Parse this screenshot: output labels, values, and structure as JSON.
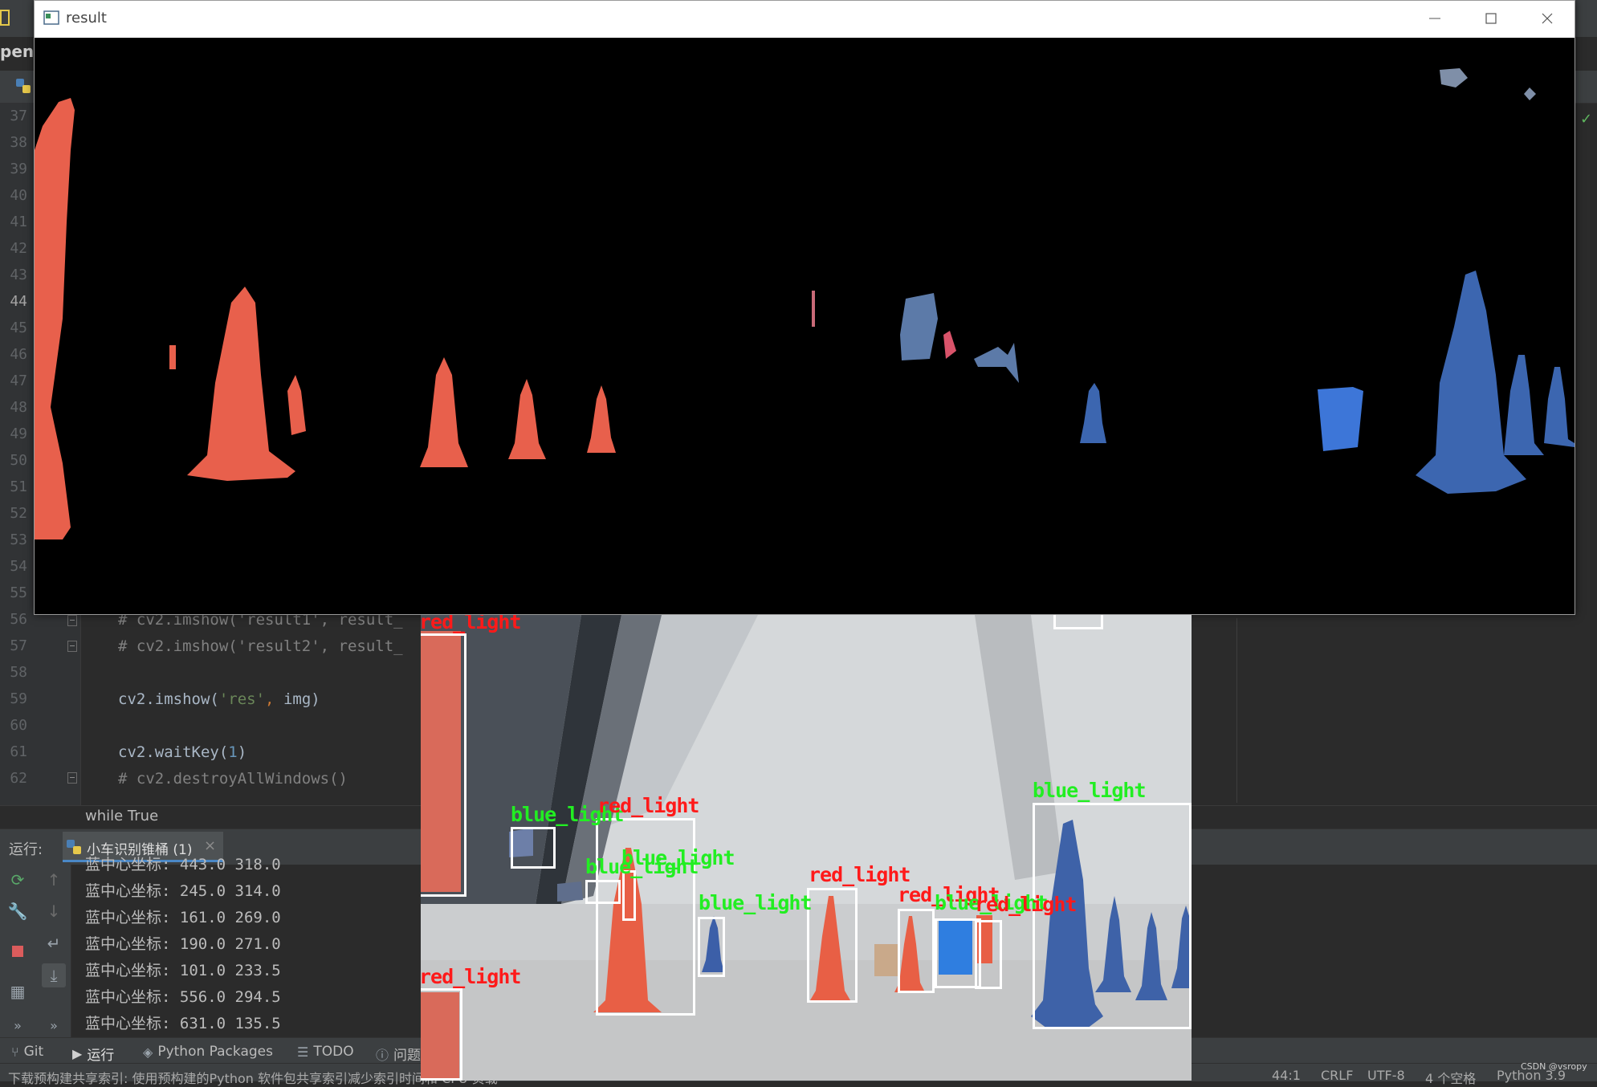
{
  "ide": {
    "project_stub": "penc",
    "gutter_lines": [
      "37",
      "38",
      "39",
      "40",
      "41",
      "42",
      "43",
      "44",
      "45",
      "46",
      "47",
      "48",
      "49",
      "50",
      "51",
      "52",
      "53",
      "54",
      "55",
      "56",
      "57",
      "58",
      "59",
      "60",
      "61",
      "62"
    ],
    "current_line": "44",
    "code": {
      "l56": {
        "text": "# cv2.imshow('result1', result_"
      },
      "l57": {
        "text": "# cv2.imshow('result2', result_"
      },
      "l59": {
        "fn": "cv2.imshow(",
        "str": "'res'",
        "comma": ", ",
        "rest": "img)"
      },
      "l61": {
        "fn": "cv2.waitKey(",
        "num": "1",
        "close": ")"
      },
      "l62": {
        "text": "# cv2.destroyAllWindows()"
      }
    },
    "breadcrumb": "while True"
  },
  "run_panel": {
    "label": "运行:",
    "tab_label": "小车识别锥桶 (1)",
    "tab_close": "×",
    "console_lines": [
      "蓝中心坐标: 443.0 318.0",
      "蓝中心坐标: 245.0 314.0",
      "蓝中心坐标: 161.0 269.0",
      "蓝中心坐标: 190.0 271.0",
      "蓝中心坐标: 101.0 233.5",
      "蓝中心坐标: 556.0 294.5",
      "蓝中心坐标: 631.0 135.5"
    ]
  },
  "tool_tabs": {
    "git": "Git",
    "run": "运行",
    "packages": "Python Packages",
    "todo": "TODO",
    "problems": "问题"
  },
  "status_bar": {
    "message": "下载预构建共享索引: 使用预构建的Python 软件包共享索引减少索引时间和 CPU 负载",
    "position": "44:1",
    "line_sep": "CRLF",
    "encoding": "UTF-8",
    "indent": "4 个空格",
    "interpreter": "Python 3.9"
  },
  "watermark": "CSDN @vsropy",
  "result_window": {
    "title": "result"
  },
  "res_window": {
    "detections": [
      {
        "label": "red_light",
        "color": "red"
      },
      {
        "label": "red_light",
        "color": "red"
      },
      {
        "label": "blue_light",
        "color": "blue"
      },
      {
        "label": "red_light",
        "color": "red"
      },
      {
        "label": "blue_light",
        "color": "blue"
      },
      {
        "label": "blue_light",
        "color": "blue"
      },
      {
        "label": "blue_light",
        "color": "blue"
      },
      {
        "label": "red_light",
        "color": "red"
      },
      {
        "label": "red_light",
        "color": "red"
      },
      {
        "label": "blue_light",
        "color": "blue"
      },
      {
        "label": "red_light",
        "color": "red"
      },
      {
        "label": "blue_light",
        "color": "blue"
      }
    ]
  },
  "colors": {
    "red_label": "#ff1a1a",
    "blue_label": "#22ee22",
    "red_cone": "#e8604c",
    "blue_cone": "#3c66b0"
  }
}
